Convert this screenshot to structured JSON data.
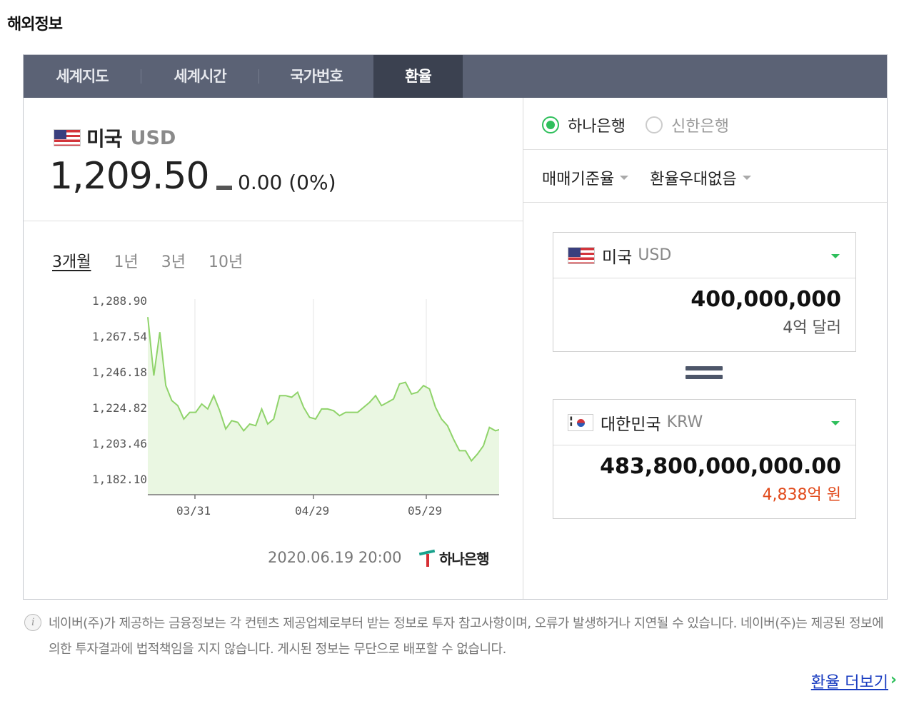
{
  "section_title": "해외정보",
  "tabs": [
    {
      "label": "세계지도"
    },
    {
      "label": "세계시간"
    },
    {
      "label": "국가번호"
    },
    {
      "label": "환율"
    }
  ],
  "active_tab": "환율",
  "currency": {
    "name": "미국",
    "code": "USD",
    "rate": "1,209.50",
    "change": "0.00 (0%)"
  },
  "periods": [
    "3개월",
    "1년",
    "3년",
    "10년"
  ],
  "active_period": "3개월",
  "chart_data": {
    "type": "area",
    "y_ticks": [
      "1,288.90",
      "1,267.54",
      "1,246.18",
      "1,224.82",
      "1,203.46",
      "1,182.10"
    ],
    "x_ticks": [
      "03/31",
      "04/29",
      "05/29"
    ],
    "ylim": [
      1182.1,
      1288.9
    ],
    "values": [
      1279,
      1244,
      1270,
      1238,
      1229,
      1226,
      1218,
      1222,
      1222,
      1227,
      1224,
      1232,
      1223,
      1212,
      1217,
      1216,
      1211,
      1215,
      1214,
      1224,
      1215,
      1218,
      1232,
      1232,
      1231,
      1234,
      1225,
      1219,
      1218,
      1224,
      1224,
      1223,
      1220,
      1222,
      1222,
      1222,
      1225,
      1228,
      1232,
      1226,
      1228,
      1230,
      1239,
      1240,
      1233,
      1234,
      1238,
      1236,
      1225,
      1218,
      1214,
      1206,
      1199,
      1199,
      1193,
      1197,
      1202,
      1213,
      1211,
      1212,
      1209,
      1209
    ],
    "line_color": "#8fd36a",
    "fill_color": "#eaf7e2"
  },
  "timestamp": "2020.06.19 20:00",
  "provider_logo_text": "하나은행",
  "banks": [
    {
      "label": "하나은행",
      "selected": true
    },
    {
      "label": "신한은행",
      "selected": false
    }
  ],
  "selects": [
    {
      "label": "매매기준율"
    },
    {
      "label": "환율우대없음"
    }
  ],
  "converter": {
    "from": {
      "name": "미국",
      "code": "USD",
      "value": "400,000,000",
      "words": "4억 달러"
    },
    "to": {
      "name": "대한민국",
      "code": "KRW",
      "value": "483,800,000,000.00",
      "words": "4,838억 원"
    }
  },
  "notice": "네이버(주)가 제공하는 금융정보는 각 컨텐츠 제공업체로부터 받는 정보로 투자 참고사항이며, 오류가 발생하거나 지연될 수 있습니다. 네이버(주)는 제공된 정보에 의한 투자결과에 법적책임을 지지 않습니다. 게시된 정보는 무단으로 배포할 수 없습니다.",
  "more_link": "환율 더보기",
  "more_arrow": "›"
}
